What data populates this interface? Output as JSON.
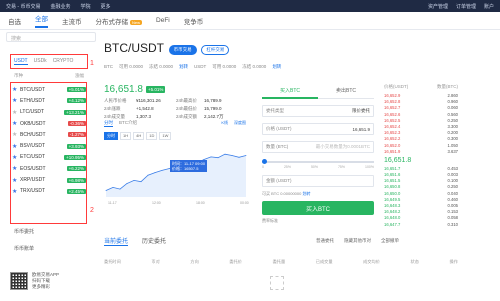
{
  "topbar": {
    "nav": [
      "交易 - 币币交易",
      "金融业务",
      "学院",
      "更多"
    ],
    "right": [
      "资产管理",
      "订单管理",
      "账户"
    ]
  },
  "tabs": [
    "自选",
    "全部",
    "主流币",
    "分布式存储",
    "DeFi",
    "竞争币"
  ],
  "tab_badge": "New",
  "left": {
    "search_placeholder": "搜索",
    "currency_tabs": [
      "USDT",
      "USDk",
      "CRYPTO"
    ],
    "col_headers": [
      "币种",
      "涨幅"
    ],
    "annotation_1": "1",
    "annotation_2": "2",
    "pairs": [
      {
        "name": "BTC/USDT",
        "chg": "+5.01%",
        "dir": "up",
        "fav": true
      },
      {
        "name": "ETH/USDT",
        "chg": "+4.12%",
        "dir": "up",
        "fav": true
      },
      {
        "name": "LTC/USDT",
        "chg": "+13.21%",
        "dir": "up",
        "fav": false
      },
      {
        "name": "OKB/USDT",
        "chg": "-0.36%",
        "dir": "down",
        "fav": true
      },
      {
        "name": "BCH/USDT",
        "chg": "-1.27%",
        "dir": "down",
        "fav": false
      },
      {
        "name": "BSV/USDT",
        "chg": "+3.93%",
        "dir": "up",
        "fav": true
      },
      {
        "name": "ETC/USDT",
        "chg": "+10.95%",
        "dir": "up",
        "fav": true
      },
      {
        "name": "EOS/USDT",
        "chg": "+6.22%",
        "dir": "up",
        "fav": true
      },
      {
        "name": "XRP/USDT",
        "chg": "+6.98%",
        "dir": "up",
        "fav": true
      },
      {
        "name": "TRX/USDT",
        "chg": "+2.45%",
        "dir": "up",
        "fav": true
      }
    ],
    "more_items": [
      "币币委托",
      "币币账单"
    ],
    "app_text": [
      "欧易交易APP",
      "扫码下载",
      "更多精彩"
    ]
  },
  "pair_header": {
    "title": "BTC/USDT",
    "pill1": "币币交易",
    "pill2": "杠杆交易",
    "sub": [
      "BTC",
      "可用 0.0000",
      "冻结 0.0000",
      "划转",
      "USDT",
      "可用 0.0000",
      "冻结 0.0000",
      "划转"
    ]
  },
  "price": {
    "last": "16,651.8",
    "change": "+5.01%",
    "stats": [
      [
        "人民币价格",
        "¥116,301.26",
        "24h最高价",
        "16,789.9"
      ],
      [
        "24h涨跌",
        "+1,542.8",
        "24h最低价",
        "15,799.0"
      ],
      [
        "24h成交量",
        "1,307.3",
        "24h成交额",
        "2,142.7万"
      ]
    ]
  },
  "chart": {
    "tabs": [
      "分时",
      "BTC介绍"
    ],
    "right_links": [
      "K线",
      "深度图"
    ],
    "time_buttons": [
      "分时",
      "1H",
      "4H",
      "1D",
      "1W"
    ],
    "tooltip_lines": [
      "时间：11-17 09:00",
      "价格：16507.5"
    ],
    "x_labels": [
      "11-17",
      "12:00",
      "18:00",
      "00:00"
    ]
  },
  "chart_data": {
    "type": "line",
    "x": [
      0,
      1,
      2,
      3,
      4,
      5,
      6,
      7,
      8,
      9,
      10,
      11,
      12,
      13,
      14,
      15,
      16,
      17,
      18,
      19,
      20
    ],
    "values": [
      15850,
      15920,
      15880,
      16010,
      16080,
      16050,
      16200,
      16260,
      16310,
      16350,
      16400,
      16460,
      16510,
      16480,
      16560,
      16620,
      16600,
      16680,
      16650,
      16610,
      16651.8
    ],
    "ylim": [
      15700,
      16800
    ]
  },
  "order": {
    "tabs": [
      "买入BTC",
      "卖出BTC"
    ],
    "type_label": "委托类型",
    "type_value": "限价委托",
    "price_label": "价格 (USDT)",
    "price_value": "16,651.9",
    "amount_label": "数量 (BTC)",
    "amount_placeholder": "最小交易数量为0.0001BTC",
    "pct": [
      "0",
      "25%",
      "50%",
      "75%",
      "100%"
    ],
    "total_label": "金额 (USDT)",
    "avail": "可买 BTC 0.00000000",
    "transfer": "划转",
    "buy_label": "买入BTC",
    "calc": "费率标准"
  },
  "book": {
    "header": [
      "价格(USDT)",
      "数量(BTC)"
    ],
    "depth_label": "深度合并",
    "asks": [
      [
        "16,652.9",
        "2.860"
      ],
      [
        "16,652.8",
        "0.960"
      ],
      [
        "16,652.7",
        "0.060"
      ],
      [
        "16,652.6",
        "0.560"
      ],
      [
        "16,652.5",
        "0.250"
      ],
      [
        "16,652.4",
        "3.300"
      ],
      [
        "16,652.3",
        "0.200"
      ],
      [
        "16,652.2",
        "0.300"
      ],
      [
        "16,652.0",
        "1.050"
      ],
      [
        "16,651.9",
        "3.637"
      ]
    ],
    "mid_price": "16,651.8",
    "bids": [
      [
        "16,651.7",
        "0.453"
      ],
      [
        "16,651.6",
        "0.003"
      ],
      [
        "16,651.5",
        "0.100"
      ],
      [
        "16,650.8",
        "0.250"
      ],
      [
        "16,650.0",
        "0.040"
      ],
      [
        "16,649.5",
        "0.460"
      ],
      [
        "16,648.3",
        "0.005"
      ],
      [
        "16,648.2",
        "0.153"
      ],
      [
        "16,648.0",
        "0.058"
      ],
      [
        "16,647.7",
        "0.310"
      ]
    ]
  },
  "orders": {
    "tabs": [
      "当前委托",
      "历史委托"
    ],
    "filters": [
      "普通委托",
      "隐藏其他币对",
      "全部撤单"
    ],
    "headers": [
      "委托时间",
      "币对",
      "方向",
      "委托价",
      "委托量",
      "已成交量",
      "成交均价",
      "状态",
      "操作"
    ]
  }
}
